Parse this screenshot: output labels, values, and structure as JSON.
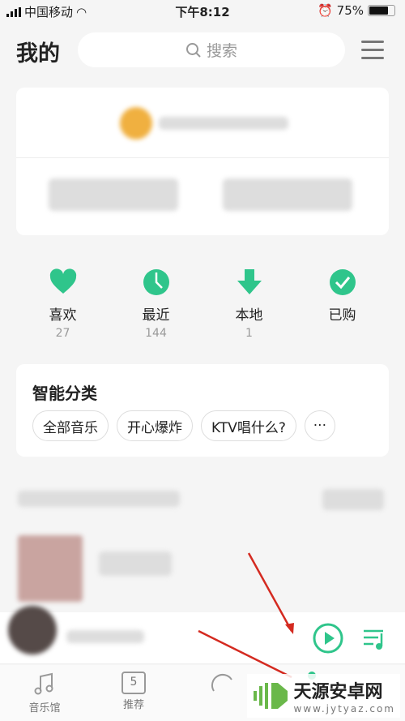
{
  "status_bar": {
    "carrier": "中国移动",
    "time": "下午8:12",
    "battery": "75%",
    "battery_level": 0.75
  },
  "header": {
    "title": "我的",
    "search_placeholder": "搜索"
  },
  "quick_links": [
    {
      "label": "喜欢",
      "count": "27",
      "icon": "heart-icon"
    },
    {
      "label": "最近",
      "count": "144",
      "icon": "clock-icon"
    },
    {
      "label": "本地",
      "count": "1",
      "icon": "download-icon"
    },
    {
      "label": "已购",
      "count": "",
      "icon": "check-circle-icon"
    }
  ],
  "smart_category": {
    "title": "智能分类",
    "chips": [
      "全部音乐",
      "开心爆炸",
      "KTV唱什么?",
      "···"
    ]
  },
  "bottom_tabs": [
    {
      "label": "音乐馆"
    },
    {
      "label": "推荐",
      "badge": "5"
    },
    {
      "label": ""
    },
    {
      "label": ""
    }
  ],
  "watermark": {
    "name": "天源安卓网",
    "url": "www.jytyaz.com"
  },
  "colors": {
    "accent": "#2fc58b",
    "annotation_arrow": "#d42a20"
  }
}
